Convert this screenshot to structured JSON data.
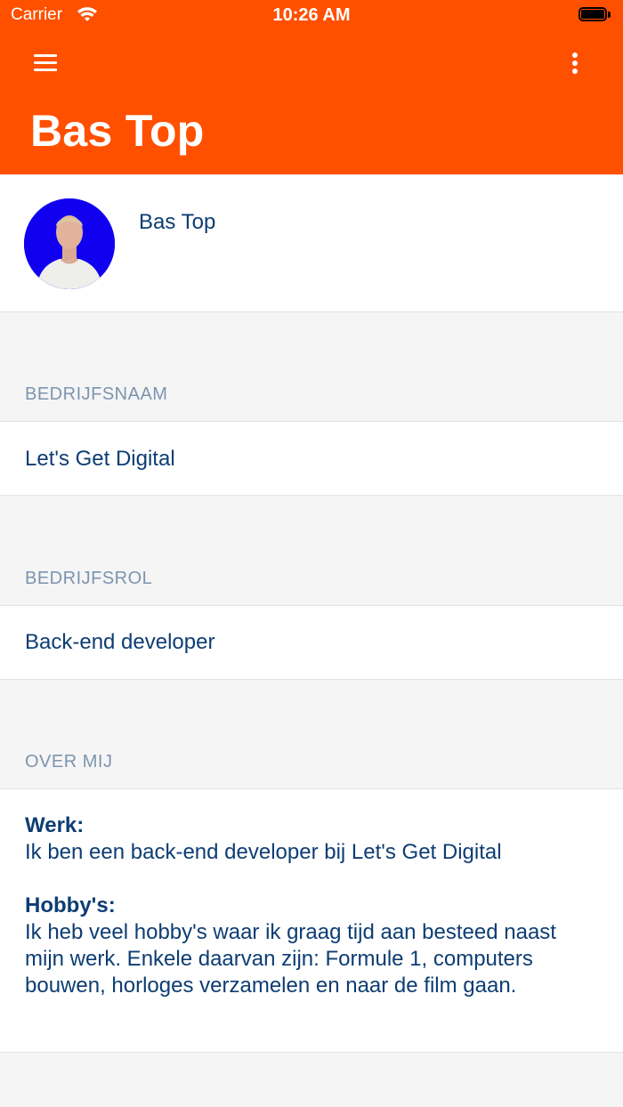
{
  "status_bar": {
    "carrier": "Carrier",
    "time": "10:26 AM"
  },
  "header": {
    "title": "Bas Top",
    "menu_icon": "hamburger-menu-icon",
    "more_icon": "more-vertical-icon",
    "background_color": "#ff5000"
  },
  "profile": {
    "name": "Bas Top",
    "avatar_background": "#1100f0"
  },
  "sections": {
    "company": {
      "label": "BEDRIJFSNAAM",
      "value": "Let's Get Digital"
    },
    "role": {
      "label": "BEDRIJFSROL",
      "value": "Back-end developer"
    },
    "about": {
      "label": "OVER MIJ",
      "work_heading": "Werk:",
      "work_text": "Ik ben een back-end developer bij Let's Get Digital",
      "hobby_heading": "Hobby's:",
      "hobby_text": "Ik heb veel hobby's waar ik graag tijd aan besteed naast mijn werk. Enkele daarvan zijn: Formule 1, computers bouwen, horloges verzamelen en naar de film gaan."
    }
  },
  "colors": {
    "accent": "#ff5000",
    "text_primary": "#0d3d73",
    "section_label": "#7d94ad",
    "background": "#f5f5f6"
  }
}
